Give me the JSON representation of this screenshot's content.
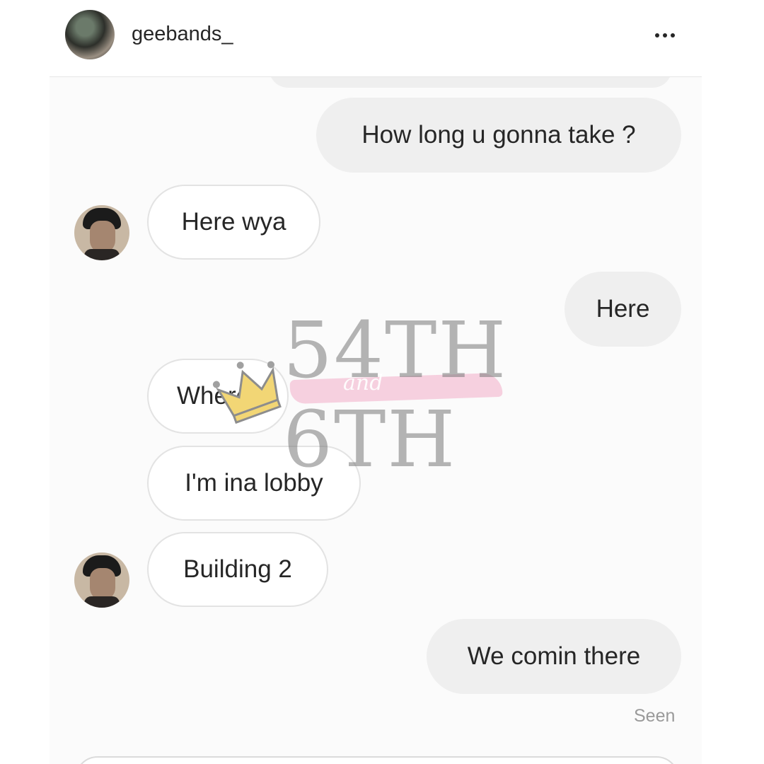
{
  "header": {
    "username": "geebands_",
    "more_icon": "more-horizontal-icon"
  },
  "messages": [
    {
      "side": "out",
      "text": "How long u gonna take ?"
    },
    {
      "side": "in",
      "text": "Here wya"
    },
    {
      "side": "out",
      "text": "Here"
    },
    {
      "side": "in",
      "text": "Where"
    },
    {
      "side": "in",
      "text": "I'm ina lobby"
    },
    {
      "side": "in",
      "text": "Building 2"
    },
    {
      "side": "out",
      "text": "We comin there"
    }
  ],
  "status": {
    "seen": "Seen"
  },
  "watermark": {
    "line1": "54TH",
    "connector": "and",
    "line2": "6TH",
    "colors": {
      "crown": "#f2d675",
      "brush": "#f4c2d6"
    }
  }
}
